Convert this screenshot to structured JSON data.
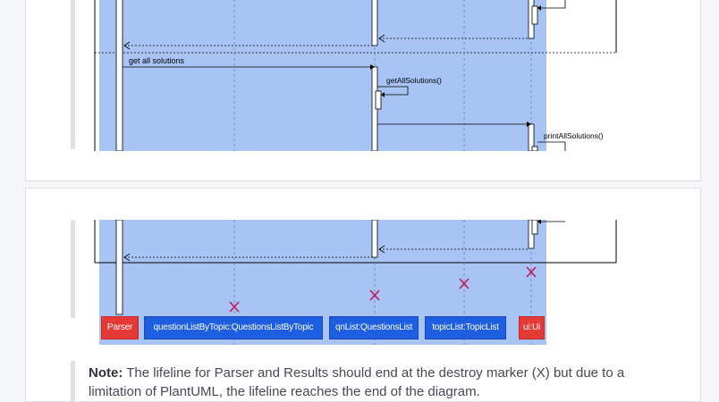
{
  "diagram_top": {
    "messages": [
      {
        "label": "get all solutions"
      },
      {
        "label": "getAllSolutions()"
      },
      {
        "label": "printAllSolutions()"
      }
    ]
  },
  "diagram_bottom": {
    "participants": [
      {
        "label": "Parser"
      },
      {
        "label": "questionListByTopic:QuestionsListByTopic"
      },
      {
        "label": "qnList:QuestionsList"
      },
      {
        "label": "topicList:TopicList"
      },
      {
        "label": "ui:Ui"
      }
    ]
  },
  "note": {
    "heading": "Note:",
    "text": "The lifeline for Parser and Results should end at the destroy marker (X) but due to a limitation of PlantUML, the lifeline reaches the end of the diagram."
  },
  "colors": {
    "diagram_background": "#a8c4f5",
    "parser_box": "#e53935",
    "participant_box": "#1e5ee0",
    "destroy_marker": "#c2185b"
  }
}
